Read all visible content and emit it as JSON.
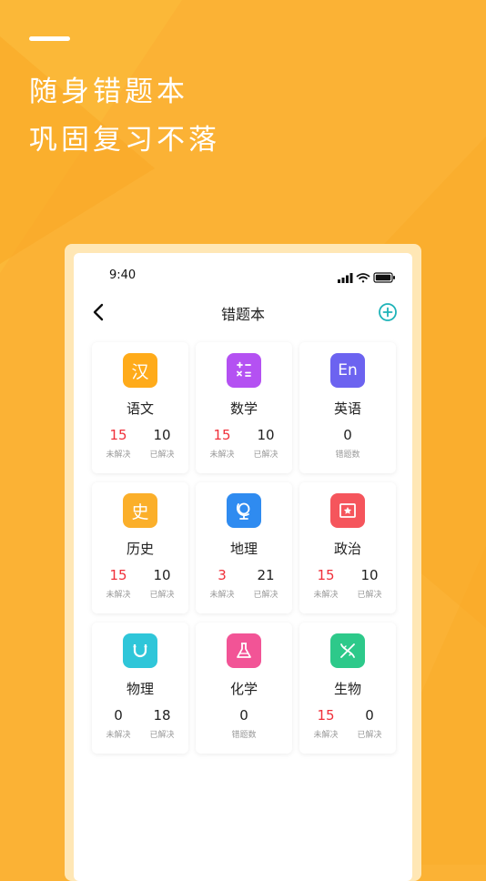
{
  "promo": {
    "line1": "随身错题本",
    "line2": "巩固复习不落"
  },
  "status_bar": {
    "time": "9:40"
  },
  "nav": {
    "title": "错题本"
  },
  "colors": {
    "background": "#fbb235",
    "accent_red": "#f0303a",
    "add_button": "#1eb3b8"
  },
  "subjects": [
    {
      "name": "语文",
      "glyph": "汉",
      "icon": "chinese-icon",
      "color": "#ffab1a",
      "stats": [
        {
          "value": "15",
          "label": "未解决",
          "red": true
        },
        {
          "value": "10",
          "label": "已解决",
          "red": false
        }
      ]
    },
    {
      "name": "数学",
      "glyph": "",
      "icon": "math-icon",
      "color": "#b451f2",
      "stats": [
        {
          "value": "15",
          "label": "未解决",
          "red": true
        },
        {
          "value": "10",
          "label": "已解决",
          "red": false
        }
      ]
    },
    {
      "name": "英语",
      "glyph": "En",
      "icon": "english-icon",
      "color": "#6c63f0",
      "stats": [
        {
          "value": "0",
          "label": "错题数",
          "red": false
        }
      ]
    },
    {
      "name": "历史",
      "glyph": "史",
      "icon": "history-icon",
      "color": "#fbaf2a",
      "stats": [
        {
          "value": "15",
          "label": "未解决",
          "red": true
        },
        {
          "value": "10",
          "label": "已解决",
          "red": false
        }
      ]
    },
    {
      "name": "地理",
      "glyph": "",
      "icon": "globe-icon",
      "color": "#2f8bf0",
      "stats": [
        {
          "value": "3",
          "label": "未解决",
          "red": true
        },
        {
          "value": "21",
          "label": "已解决",
          "red": false
        }
      ]
    },
    {
      "name": "政治",
      "glyph": "",
      "icon": "politics-icon",
      "color": "#f5555c",
      "stats": [
        {
          "value": "15",
          "label": "未解决",
          "red": true
        },
        {
          "value": "10",
          "label": "已解决",
          "red": false
        }
      ]
    },
    {
      "name": "物理",
      "glyph": "",
      "icon": "magnet-icon",
      "color": "#2fc6d9",
      "stats": [
        {
          "value": "0",
          "label": "未解决",
          "red": false
        },
        {
          "value": "18",
          "label": "已解决",
          "red": false
        }
      ]
    },
    {
      "name": "化学",
      "glyph": "",
      "icon": "flask-icon",
      "color": "#f25496",
      "stats": [
        {
          "value": "0",
          "label": "错题数",
          "red": false
        }
      ]
    },
    {
      "name": "生物",
      "glyph": "",
      "icon": "dna-icon",
      "color": "#2dc98a",
      "stats": [
        {
          "value": "15",
          "label": "未解决",
          "red": true
        },
        {
          "value": "0",
          "label": "已解决",
          "red": false
        }
      ]
    }
  ]
}
